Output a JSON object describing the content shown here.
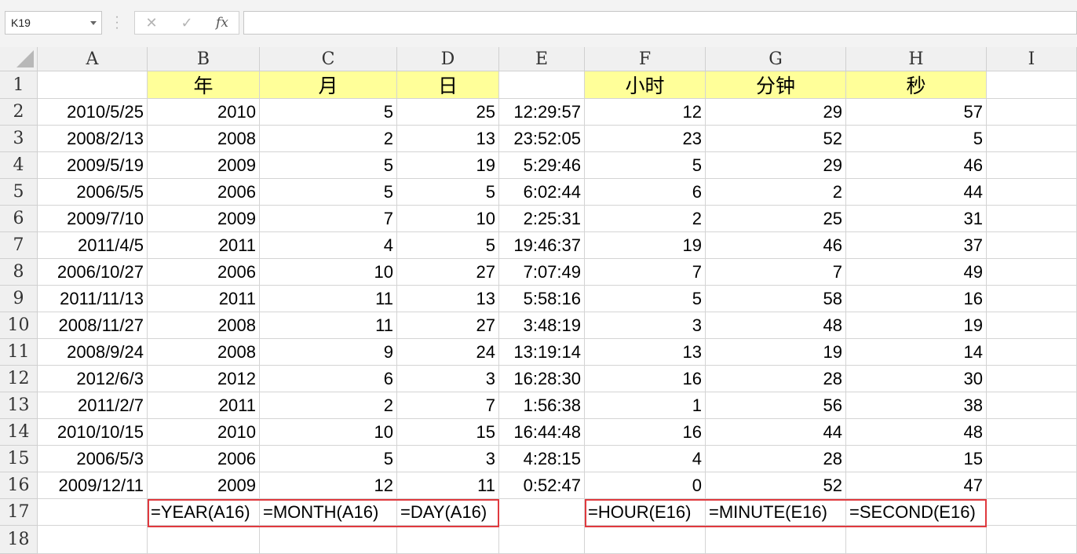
{
  "formula_bar": {
    "name_box": "K19",
    "cancel_icon": "✕",
    "enter_icon": "✓",
    "function_icon": "fx",
    "formula": ""
  },
  "columns": [
    "A",
    "B",
    "C",
    "D",
    "E",
    "F",
    "G",
    "H",
    "I"
  ],
  "rows": [
    "1",
    "2",
    "3",
    "4",
    "5",
    "6",
    "7",
    "8",
    "9",
    "10",
    "11",
    "12",
    "13",
    "14",
    "15",
    "16",
    "17",
    "18"
  ],
  "headers": {
    "B": "年",
    "C": "月",
    "D": "日",
    "F": "小时",
    "G": "分钟",
    "H": "秒"
  },
  "data_rows": [
    [
      "2010/5/25",
      "2010",
      "5",
      "25",
      "12:29:57",
      "12",
      "29",
      "57"
    ],
    [
      "2008/2/13",
      "2008",
      "2",
      "13",
      "23:52:05",
      "23",
      "52",
      "5"
    ],
    [
      "2009/5/19",
      "2009",
      "5",
      "19",
      "5:29:46",
      "5",
      "29",
      "46"
    ],
    [
      "2006/5/5",
      "2006",
      "5",
      "5",
      "6:02:44",
      "6",
      "2",
      "44"
    ],
    [
      "2009/7/10",
      "2009",
      "7",
      "10",
      "2:25:31",
      "2",
      "25",
      "31"
    ],
    [
      "2011/4/5",
      "2011",
      "4",
      "5",
      "19:46:37",
      "19",
      "46",
      "37"
    ],
    [
      "2006/10/27",
      "2006",
      "10",
      "27",
      "7:07:49",
      "7",
      "7",
      "49"
    ],
    [
      "2011/11/13",
      "2011",
      "11",
      "13",
      "5:58:16",
      "5",
      "58",
      "16"
    ],
    [
      "2008/11/27",
      "2008",
      "11",
      "27",
      "3:48:19",
      "3",
      "48",
      "19"
    ],
    [
      "2008/9/24",
      "2008",
      "9",
      "24",
      "13:19:14",
      "13",
      "19",
      "14"
    ],
    [
      "2012/6/3",
      "2012",
      "6",
      "3",
      "16:28:30",
      "16",
      "28",
      "30"
    ],
    [
      "2011/2/7",
      "2011",
      "2",
      "7",
      "1:56:38",
      "1",
      "56",
      "38"
    ],
    [
      "2010/10/15",
      "2010",
      "10",
      "15",
      "16:44:48",
      "16",
      "44",
      "48"
    ],
    [
      "2006/5/3",
      "2006",
      "5",
      "3",
      "4:28:15",
      "4",
      "28",
      "15"
    ],
    [
      "2009/12/11",
      "2009",
      "12",
      "11",
      "0:52:47",
      "0",
      "52",
      "47"
    ]
  ],
  "formulas": {
    "B": "=YEAR(A16)",
    "C": "=MONTH(A16)",
    "D": "=DAY(A16)",
    "F": "=HOUR(E16)",
    "G": "=MINUTE(E16)",
    "H": "=SECOND(E16)"
  },
  "colors": {
    "header_fill": "#ffff99",
    "highlight_border": "#e0393e"
  }
}
